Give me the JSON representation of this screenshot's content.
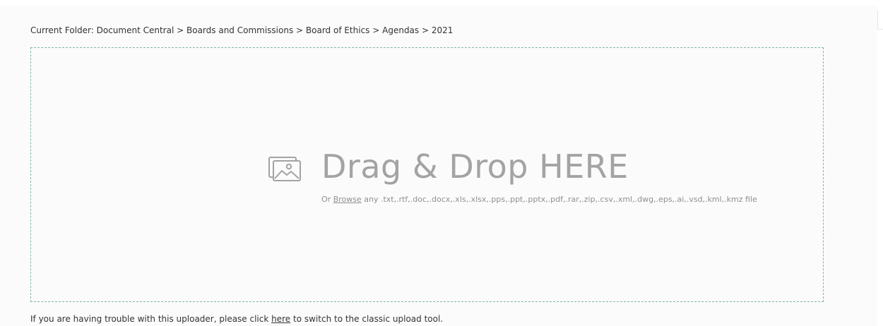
{
  "breadcrumb": {
    "prefix": "Current Folder: ",
    "items": [
      "Document Central",
      "Boards and Commissions",
      "Board of Ethics",
      "Agendas",
      "2021"
    ],
    "separator": " > "
  },
  "dropzone": {
    "icon": "image-icon",
    "title": "Drag & Drop HERE",
    "or_text": "Or ",
    "browse_label": "Browse",
    "file_types_text": " any .txt,.rtf,.doc,.docx,.xls,.xlsx,.pps,.ppt,.pptx,.pdf,.rar,.zip,.csv,.xml,.dwg,.eps,.ai,.vsd,.kml,.kmz file",
    "border_color": "#7fb5ab",
    "text_color": "#a3a3a3"
  },
  "footer": {
    "before_link": "If you are having trouble with this uploader, please click ",
    "link_label": "here",
    "after_link": " to switch to the classic upload tool."
  }
}
